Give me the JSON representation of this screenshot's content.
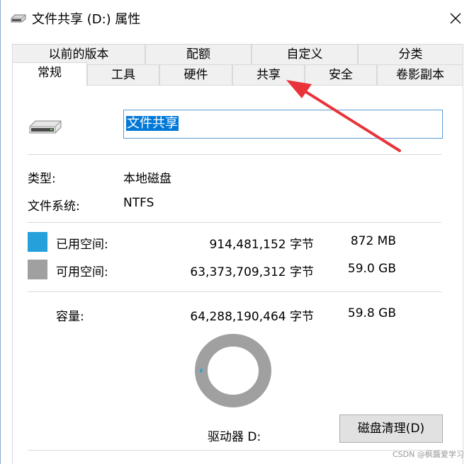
{
  "window": {
    "title": "文件共享 (D:) 属性"
  },
  "tabs_row1": [
    {
      "label": "以前的版本"
    },
    {
      "label": "配额"
    },
    {
      "label": "自定义"
    },
    {
      "label": "分类"
    }
  ],
  "tabs_row2": [
    {
      "label": "常规"
    },
    {
      "label": "工具"
    },
    {
      "label": "硬件"
    },
    {
      "label": "共享"
    },
    {
      "label": "安全"
    },
    {
      "label": "卷影副本"
    }
  ],
  "general": {
    "volume_name": "文件共享",
    "type_label": "类型:",
    "type_value": "本地磁盘",
    "fs_label": "文件系统:",
    "fs_value": "NTFS",
    "used_label": "已用空间:",
    "used_bytes": "914,481,152 字节",
    "used_size": "872 MB",
    "free_label": "可用空间:",
    "free_bytes": "63,373,709,312 字节",
    "free_size": "59.0 GB",
    "capacity_label": "容量:",
    "capacity_bytes": "64,288,190,464 字节",
    "capacity_size": "59.8 GB",
    "drive_label": "驱动器 D:",
    "cleanup_button": "磁盘清理(D)",
    "used_fraction": 0.0142
  },
  "colors": {
    "used": "#26a0da",
    "free": "#a0a0a0",
    "annotation_arrow": "#e8333a"
  },
  "watermark": "CSDN @枫醬爱学习"
}
